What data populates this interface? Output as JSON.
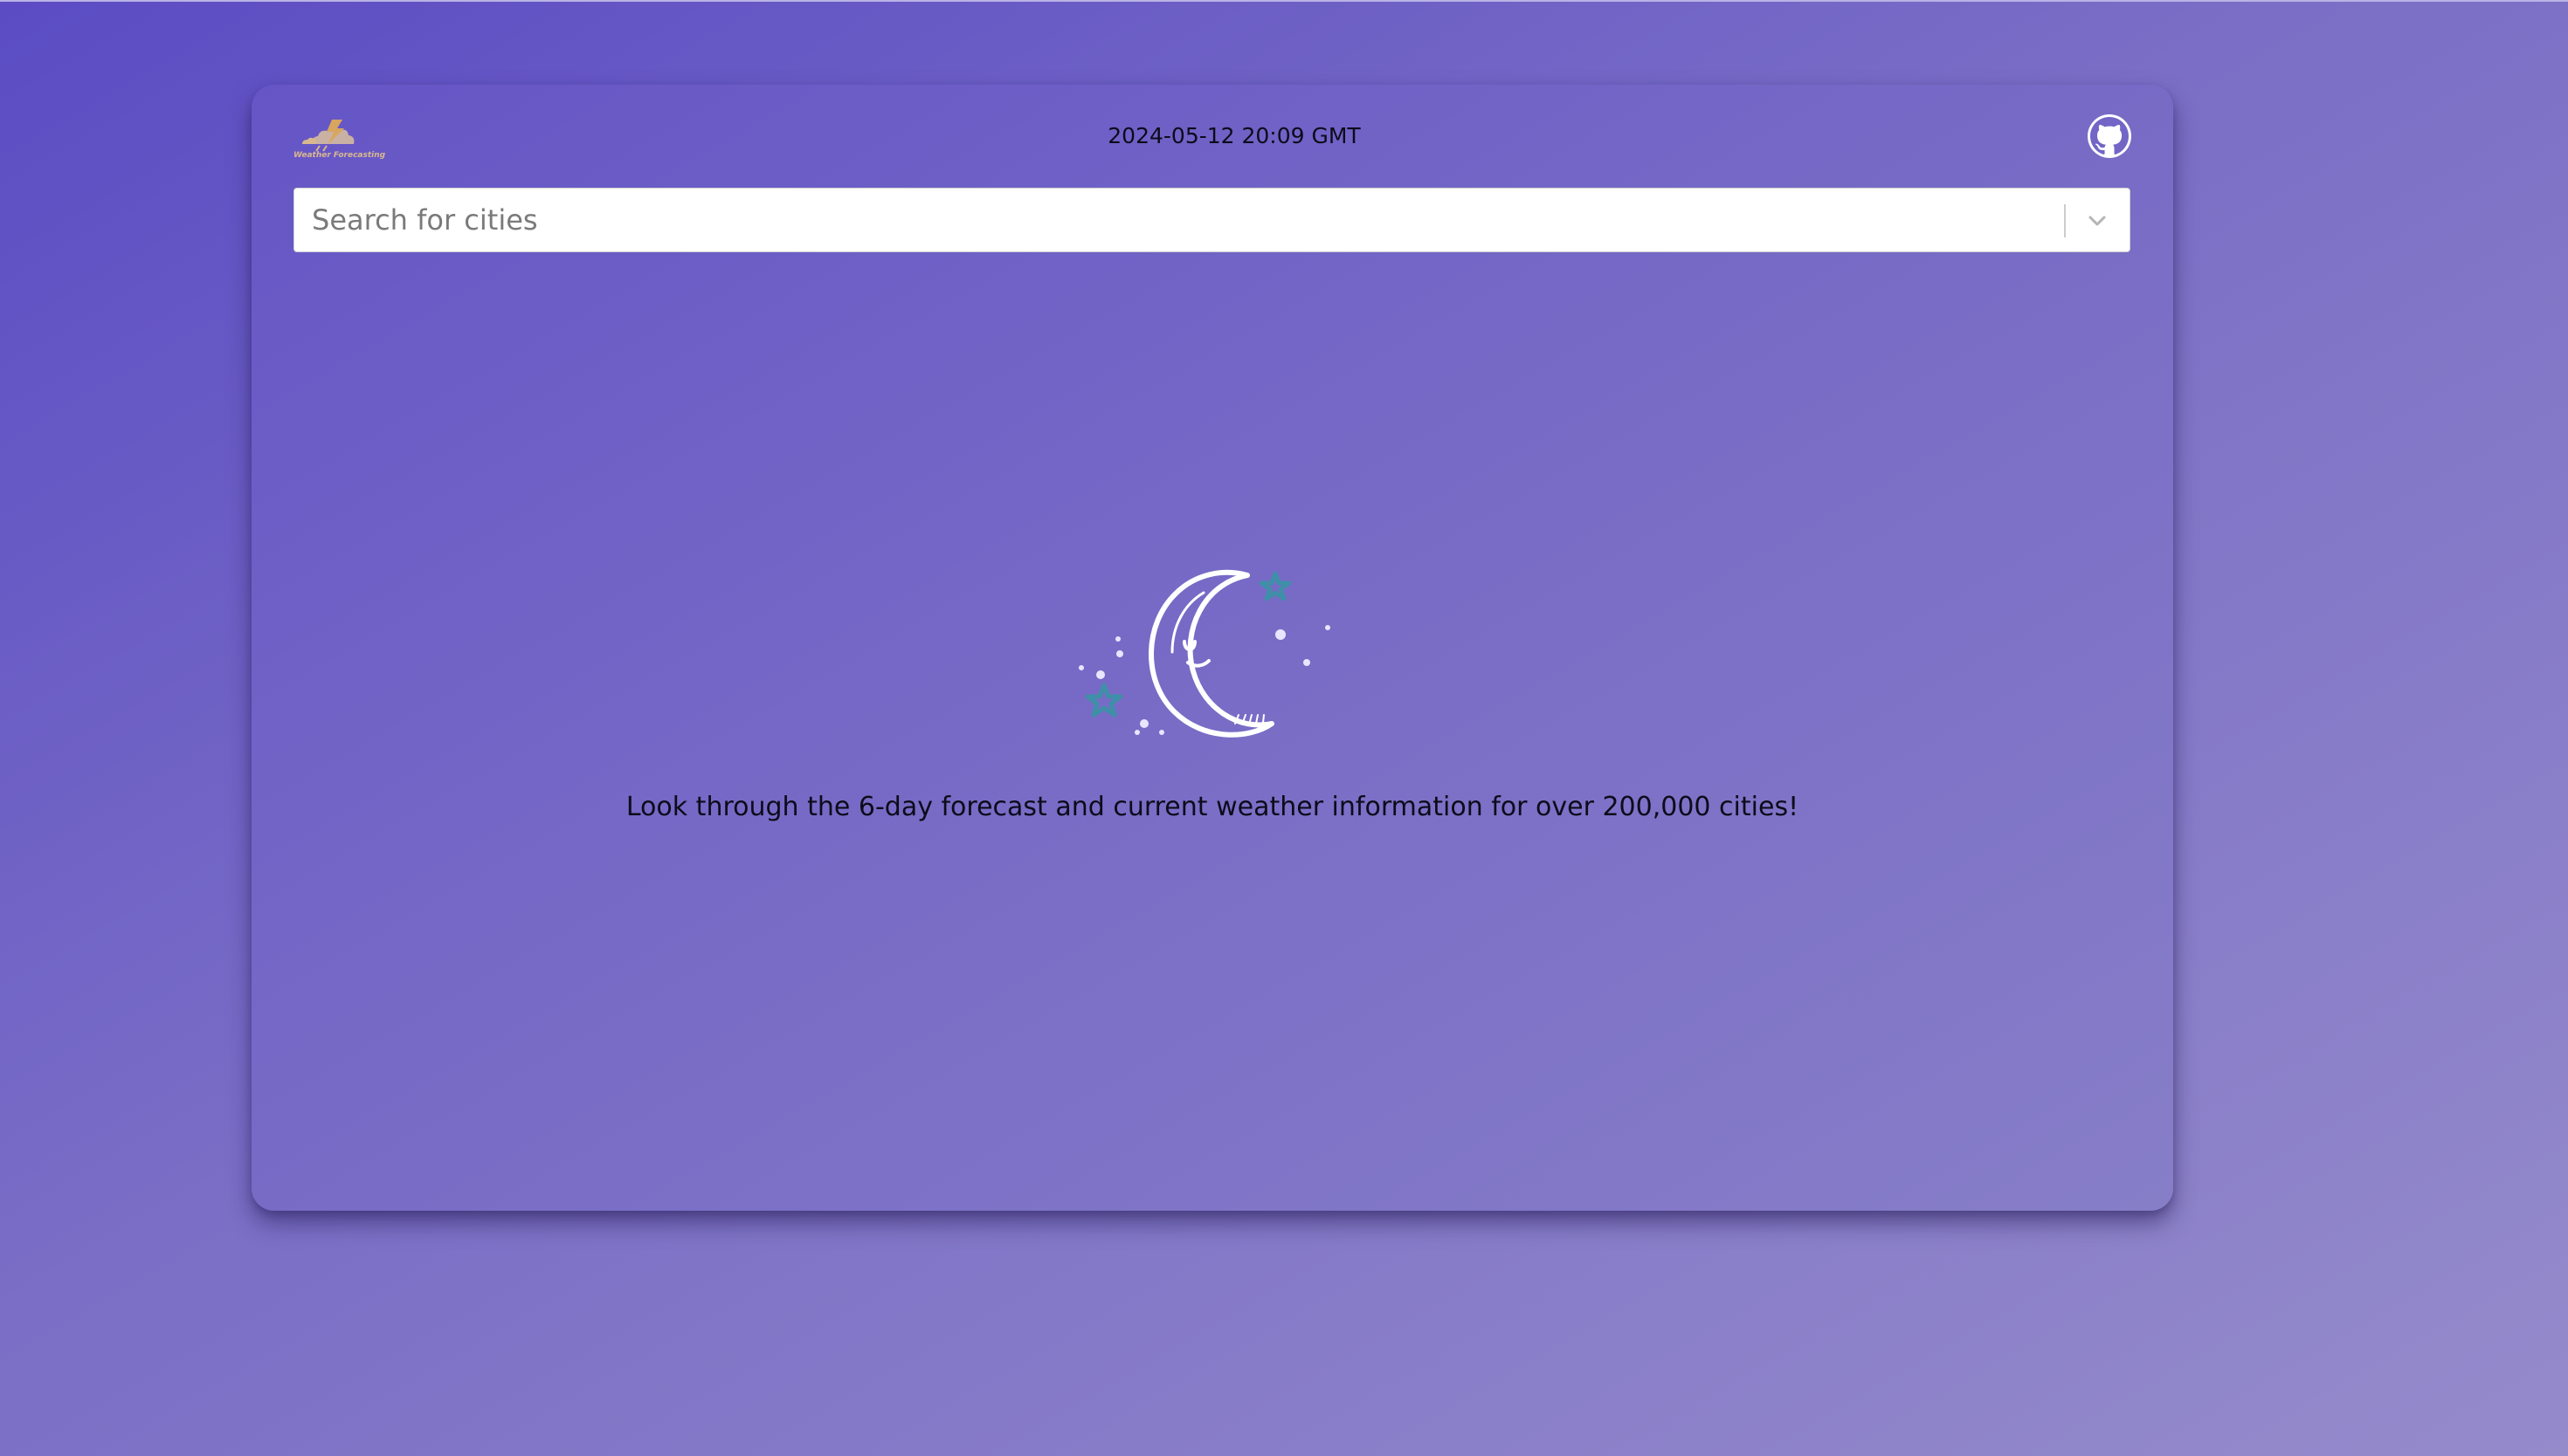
{
  "header": {
    "logo_text": "Weather Forecasting",
    "datetime": "2024-05-12 20:09 GMT",
    "github_icon": "github-icon"
  },
  "search": {
    "placeholder": "Search for cities",
    "value": "",
    "dropdown_icon": "chevron-down-icon"
  },
  "main": {
    "illustration": "moon-stars-illustration",
    "tagline": "Look through the 6-day forecast and current weather information for over 200,000 cities!"
  },
  "colors": {
    "background": "#6a5cc6",
    "card": "#7265c6",
    "star": "#3f8fa8",
    "logo": "#d8b88e",
    "text": "#0d0b1a"
  }
}
